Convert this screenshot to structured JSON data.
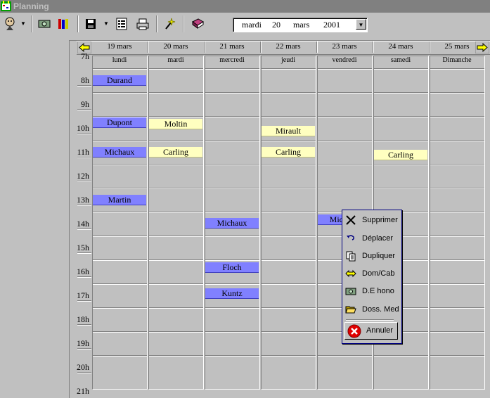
{
  "window": {
    "title": "Planning"
  },
  "toolbar": {
    "icons": [
      "patient-icon",
      "banknote-icon",
      "books-icon",
      "save-icon",
      "list-icon",
      "printer-icon",
      "magic-icon",
      "agenda-book-icon"
    ]
  },
  "date_selector": {
    "weekday": "mardi",
    "day": "20",
    "month": "mars",
    "year": "2001"
  },
  "days": [
    {
      "date": "19 mars",
      "name": "lundi"
    },
    {
      "date": "20 mars",
      "name": "mardi"
    },
    {
      "date": "21 mars",
      "name": "mercredi"
    },
    {
      "date": "22 mars",
      "name": "jeudi"
    },
    {
      "date": "23 mars",
      "name": "vendredi"
    },
    {
      "date": "24 mars",
      "name": "samedi"
    },
    {
      "date": "25 mars",
      "name": "Dimanche"
    }
  ],
  "hours": [
    "7h",
    "8h",
    "9h",
    "10h",
    "11h",
    "12h",
    "13h",
    "14h",
    "15h",
    "16h",
    "17h",
    "18h",
    "19h",
    "20h",
    "21h"
  ],
  "appointments": [
    {
      "name": "Durand",
      "day": 0,
      "start": 7.6,
      "type": "blue"
    },
    {
      "name": "Dupont",
      "day": 0,
      "start": 9.35,
      "type": "blue"
    },
    {
      "name": "Michaux",
      "day": 0,
      "start": 10.6,
      "type": "blue"
    },
    {
      "name": "Martin",
      "day": 0,
      "start": 12.6,
      "type": "blue"
    },
    {
      "name": "Moltin",
      "day": 1,
      "start": 9.4,
      "type": "yellow"
    },
    {
      "name": "Carling",
      "day": 1,
      "start": 10.6,
      "type": "yellow"
    },
    {
      "name": "Michaux",
      "day": 2,
      "start": 13.55,
      "type": "blue"
    },
    {
      "name": "Floch",
      "day": 2,
      "start": 15.4,
      "type": "blue"
    },
    {
      "name": "Kuntz",
      "day": 2,
      "start": 16.5,
      "type": "blue"
    },
    {
      "name": "Mirault",
      "day": 3,
      "start": 9.7,
      "type": "yellow"
    },
    {
      "name": "Carling",
      "day": 3,
      "start": 10.6,
      "type": "yellow"
    },
    {
      "name": "Michaux",
      "day": 4,
      "start": 13.4,
      "type": "blue"
    },
    {
      "name": "Carling",
      "day": 5,
      "start": 10.7,
      "type": "yellow"
    }
  ],
  "context_menu": {
    "items": [
      {
        "label": "Supprimer",
        "icon": "delete-x-icon"
      },
      {
        "label": "Déplacer",
        "icon": "move-arrow-icon"
      },
      {
        "label": "Dupliquer",
        "icon": "duplicate-icon"
      },
      {
        "label": "Dom/Cab",
        "icon": "dom-cab-arrows-icon"
      },
      {
        "label": "D.E hono",
        "icon": "fee-banknote-icon"
      },
      {
        "label": "Doss. Med",
        "icon": "open-folder-icon"
      }
    ],
    "cancel_label": "Annuler"
  },
  "colors": {
    "blue_appt": "#8080ff",
    "yellow_appt": "#ffffc0",
    "menu_border": "#000080"
  }
}
